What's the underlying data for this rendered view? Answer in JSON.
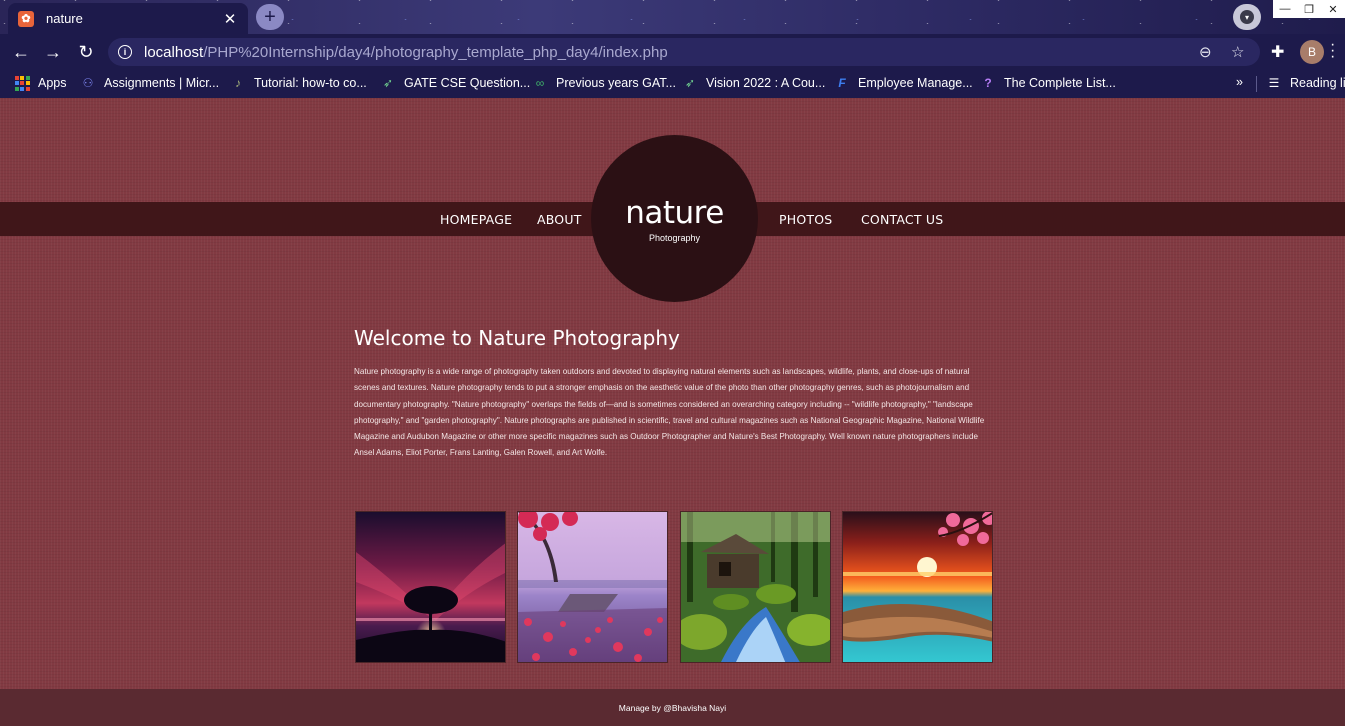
{
  "browser": {
    "tab": {
      "title": "nature",
      "favicon": "xampp-icon"
    },
    "new_tab_label": "+",
    "profile_initial": "B",
    "url": {
      "host": "localhost",
      "path": "/PHP%20Internship/day4/photography_template_php_day4/index.php"
    },
    "bookmarks": [
      {
        "label": "Apps",
        "icon": "apps-grid-icon"
      },
      {
        "label": "Assignments | Micr...",
        "icon": "teams-icon"
      },
      {
        "label": "Tutorial: how-to co...",
        "icon": "guitar-icon"
      },
      {
        "label": "GATE CSE Question...",
        "icon": "rocket-icon"
      },
      {
        "label": "Previous years GAT...",
        "icon": "infinity-icon"
      },
      {
        "label": "Vision 2022 : A Cou...",
        "icon": "rocket-icon"
      },
      {
        "label": "Employee Manage...",
        "icon": "f-logo-icon"
      },
      {
        "label": "The Complete List...",
        "icon": "question-icon"
      }
    ],
    "overflow_label": "»",
    "reading_list_label": "Reading lis"
  },
  "site": {
    "nav": {
      "homepage": "HOMEPAGE",
      "about": "ABOUT",
      "photos": "PHOTOS",
      "contact": "CONTACT US"
    },
    "logo": {
      "main": "nature",
      "sub": "Photography"
    },
    "welcome_title": "Welcome to Nature Photography",
    "intro_text": "Nature photography is a wide range of photography taken outdoors and devoted to displaying natural elements such as landscapes, wildlife, plants, and close-ups of natural scenes and textures. Nature photography tends to put a stronger emphasis on the aesthetic value of the photo than other photography genres, such as photojournalism and documentary photography. \"Nature photography\" overlaps the fields of—and is sometimes considered an overarching category including -- \"wildlife photography,\" \"landscape photography,\" and \"garden photography\". Nature photographs are published in scientific, travel and cultural magazines such as National Geographic Magazine, National Wildlife Magazine and Audubon Magazine or other more specific magazines such as Outdoor Photographer and Nature's Best Photography. Well known nature photographers include Ansel Adams, Eliot Porter, Frans Lanting, Galen Rowell, and Art Wolfe.",
    "gallery": [
      {
        "subject": "tree-at-sunset"
      },
      {
        "subject": "pink-lake-pier"
      },
      {
        "subject": "forest-waterfall-hut"
      },
      {
        "subject": "sunset-sea-blossoms"
      }
    ],
    "footer": "Manage by @Bhavisha Nayi"
  },
  "colors": {
    "page_bg": "#823a42",
    "nav_band": "#401619",
    "logo_circle": "#2b1014",
    "footer_bg": "#5a2a31",
    "chrome_bg": "#1d1a4b"
  }
}
